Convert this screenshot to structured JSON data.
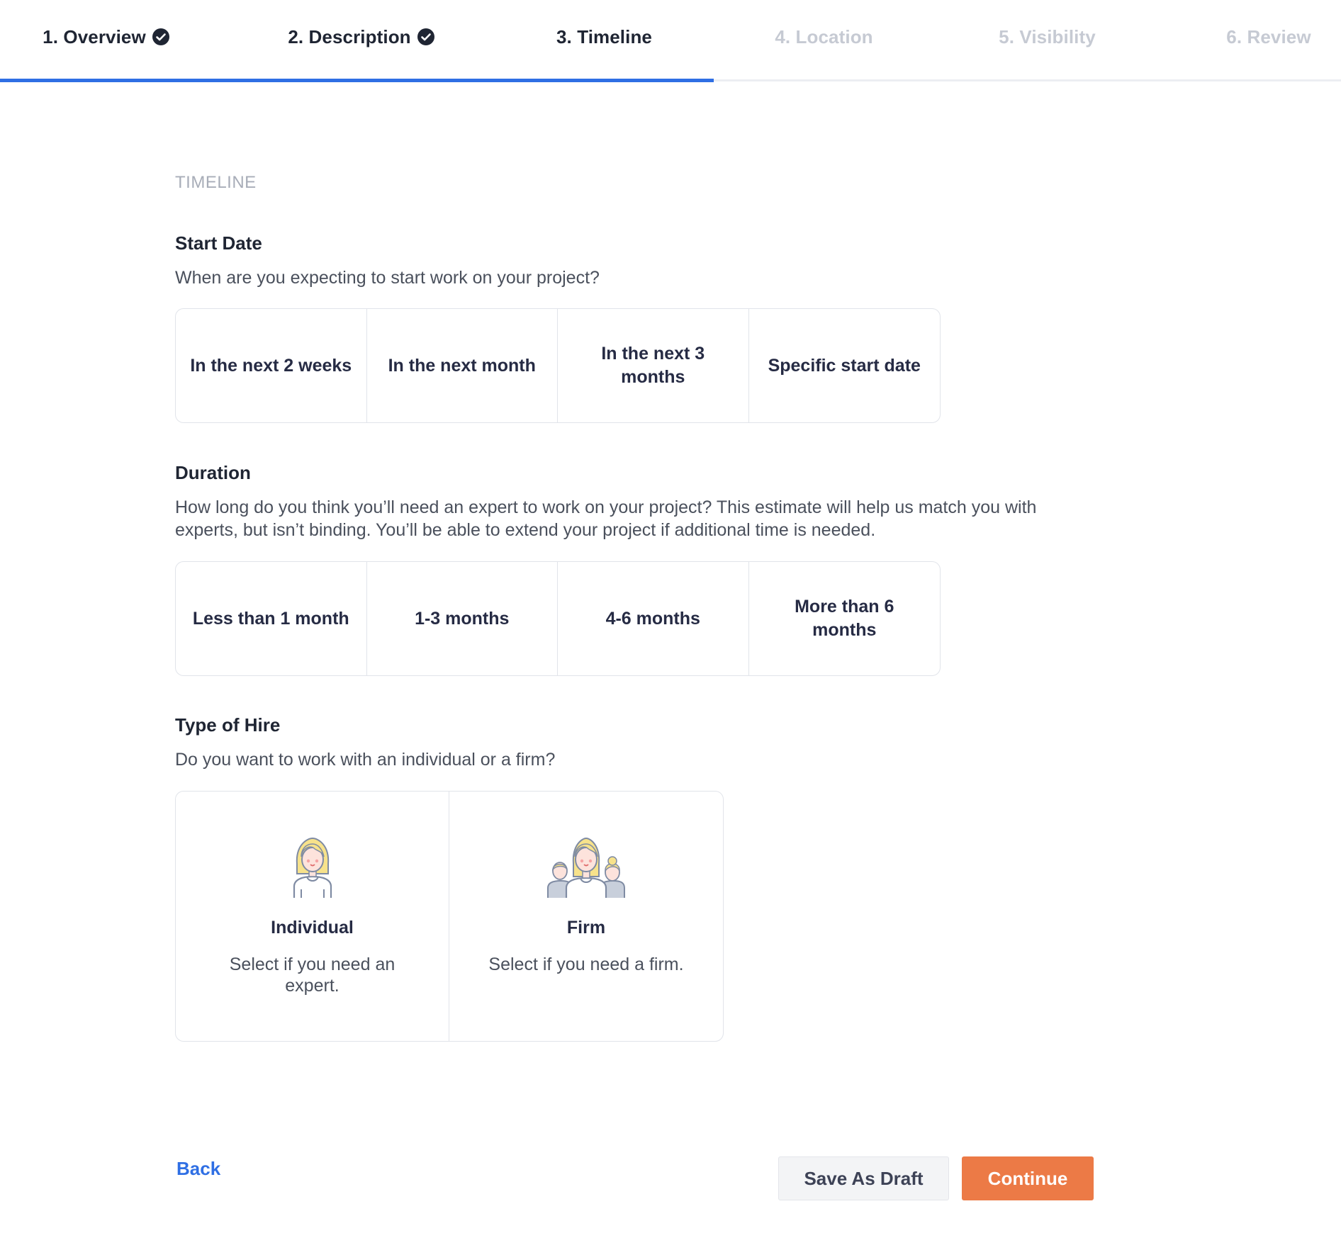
{
  "stepper": {
    "steps": [
      {
        "label": "1. Overview",
        "state": "done"
      },
      {
        "label": "2. Description",
        "state": "done"
      },
      {
        "label": "3. Timeline",
        "state": "active"
      },
      {
        "label": "4. Location",
        "state": "todo"
      },
      {
        "label": "5. Visibility",
        "state": "todo"
      },
      {
        "label": "6. Review",
        "state": "todo"
      }
    ]
  },
  "section_label": "TIMELINE",
  "start_date": {
    "title": "Start Date",
    "description": "When are you expecting to start work on your project?",
    "options": [
      "In the next 2 weeks",
      "In the next month",
      "In the next 3 months",
      "Specific start date"
    ]
  },
  "duration": {
    "title": "Duration",
    "description": "How long do you think you’ll need an expert to work on your project? This estimate will help us match you with experts, but isn’t binding. You’ll be able to extend your project if additional time is needed.",
    "options": [
      "Less than 1 month",
      "1-3 months",
      "4-6 months",
      "More than 6 months"
    ]
  },
  "hire_type": {
    "title": "Type of Hire",
    "description": "Do you want to work with an individual or a firm?",
    "options": [
      {
        "title": "Individual",
        "description": "Select if you need an expert.",
        "icon": "individual-icon"
      },
      {
        "title": "Firm",
        "description": "Select if you need a firm.",
        "icon": "firm-icon"
      }
    ]
  },
  "footer": {
    "back_label": "Back",
    "draft_label": "Save As Draft",
    "continue_label": "Continue"
  },
  "colors": {
    "accent": "#2f6fe4",
    "primary_button": "#ec7a46",
    "inactive_step": "#c6cad3"
  }
}
